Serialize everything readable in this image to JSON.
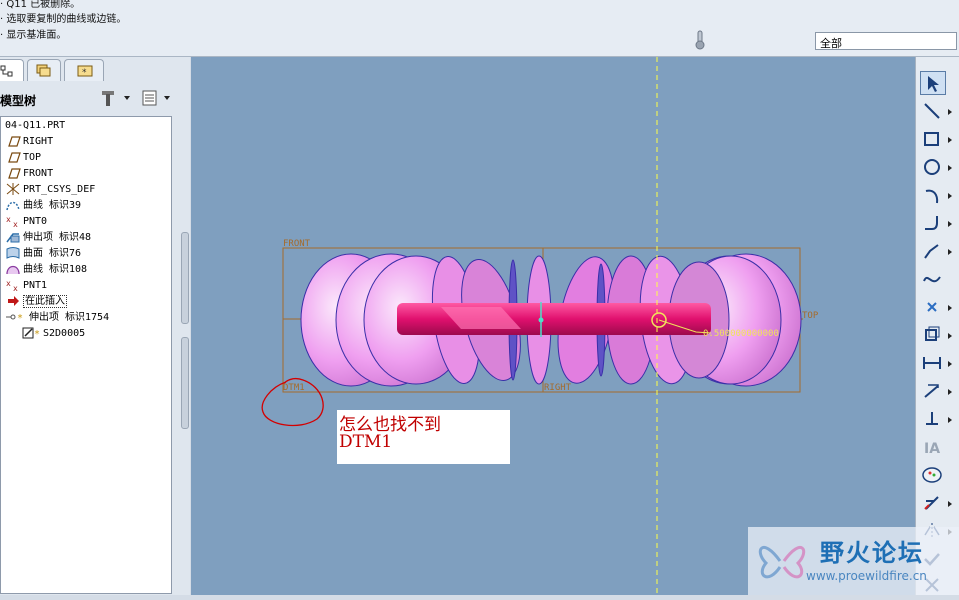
{
  "message_area": {
    "lines": [
      "· Q11 已被删除。",
      "· 选取要复制的曲线或边链。",
      "· 显示基准面。"
    ]
  },
  "filter": {
    "value": "全部"
  },
  "model_tree": {
    "title": "模型树",
    "nodes": [
      {
        "label": "04-Q11.PRT",
        "icon": "part-icon"
      },
      {
        "label": "RIGHT",
        "icon": "datum-plane-icon"
      },
      {
        "label": "TOP",
        "icon": "datum-plane-icon"
      },
      {
        "label": "FRONT",
        "icon": "datum-plane-icon"
      },
      {
        "label": "PRT_CSYS_DEF",
        "icon": "csys-icon"
      },
      {
        "label": "曲线 标识39",
        "icon": "curve-icon"
      },
      {
        "label": "PNT0",
        "icon": "datum-point-icon"
      },
      {
        "label": "伸出项 标识48",
        "icon": "extrude-icon"
      },
      {
        "label": "曲面 标识76",
        "icon": "surface-icon"
      },
      {
        "label": "曲线 标识108",
        "icon": "curve-icon"
      },
      {
        "label": "PNT1",
        "icon": "datum-point-icon"
      },
      {
        "label": "在此插入",
        "icon": "insert-arrow-icon"
      },
      {
        "label": "伸出项 标识1754",
        "icon": "extrude-icon"
      },
      {
        "label": "S2D0005",
        "icon": "sketch-icon"
      }
    ]
  },
  "viewport": {
    "labels": {
      "front": "FRONT",
      "top": "TOP",
      "right": "RIGHT",
      "dtm1": "DTM1",
      "dimension": "0.500000000000"
    },
    "annotation": {
      "line1": "怎么也找不到",
      "line2": "DTM1"
    },
    "colors": {
      "background": "#7f9fbf",
      "datum": "#a56b2b",
      "geometry": "#e88fe6",
      "solid": "#e0106e",
      "axis_guide": "#ffff44",
      "annotation": "#c00000"
    }
  },
  "toolbar": {
    "tools": [
      "select-icon",
      "line-icon",
      "rectangle-icon",
      "circle-icon",
      "arc-icon",
      "fillet-icon",
      "chamfer-icon",
      "spline-icon",
      "point-icon",
      "offset-icon",
      "dimension-icon",
      "modify-icon",
      "constraint-icon",
      "text-icon",
      "palette-icon",
      "trim-icon",
      "mirror-icon",
      "done-icon",
      "cancel-icon"
    ]
  },
  "watermark": {
    "title": "野火论坛",
    "url": "www.proewildfire.cn"
  }
}
